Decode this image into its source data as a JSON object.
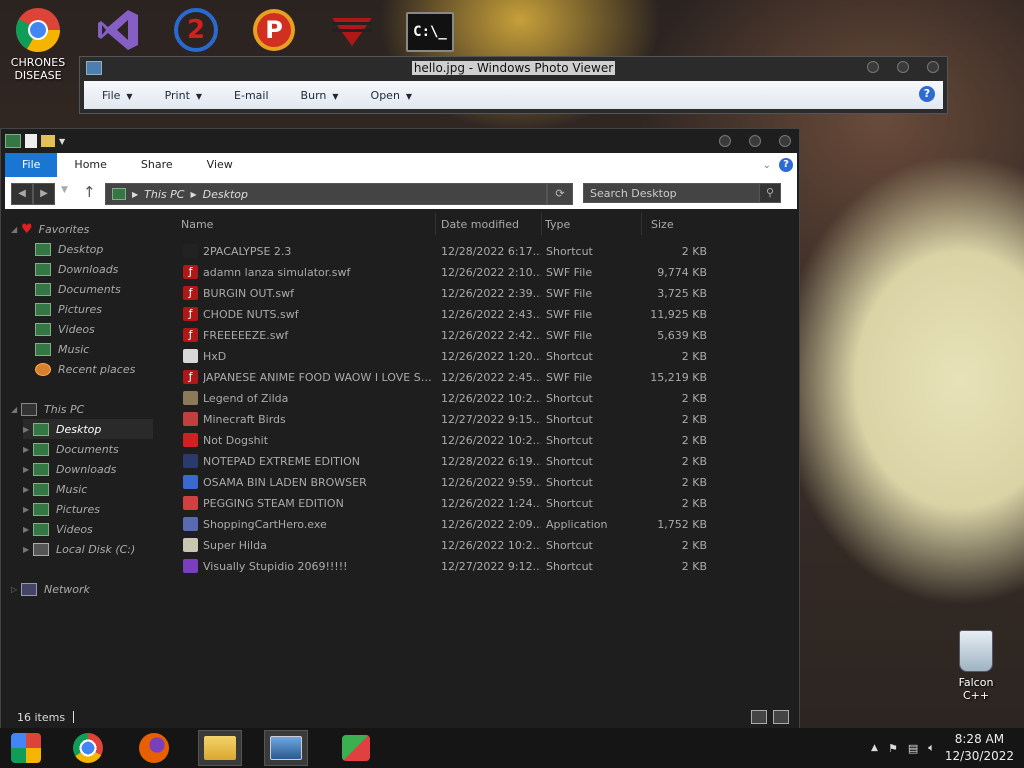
{
  "desktop": {
    "icons": [
      {
        "name": "chrome",
        "label": "CHRONES DISEASE"
      },
      {
        "name": "visual-studio",
        "label": ""
      },
      {
        "name": "game-2",
        "label": ""
      },
      {
        "name": "game-p",
        "label": ""
      },
      {
        "name": "game-z",
        "label": ""
      },
      {
        "name": "cmd",
        "label": ""
      }
    ],
    "recycle_bin_label": "Falcon C++"
  },
  "photo_viewer": {
    "title": "hello.jpg - Windows Photo Viewer",
    "menu": [
      {
        "label": "File",
        "caret": true
      },
      {
        "label": "Print",
        "caret": true
      },
      {
        "label": "E-mail",
        "caret": false
      },
      {
        "label": "Burn",
        "caret": true
      },
      {
        "label": "Open",
        "caret": true
      }
    ],
    "help": "?"
  },
  "explorer": {
    "ribbon_tabs": [
      "File",
      "Home",
      "Share",
      "View"
    ],
    "breadcrumb": {
      "root": "This PC",
      "current": "Desktop"
    },
    "search_placeholder": "Search Desktop",
    "nav": {
      "favorites_label": "Favorites",
      "favorites": [
        "Desktop",
        "Downloads",
        "Documents",
        "Pictures",
        "Videos",
        "Music",
        "Recent places"
      ],
      "this_pc_label": "This PC",
      "this_pc": [
        "Desktop",
        "Documents",
        "Downloads",
        "Music",
        "Pictures",
        "Videos",
        "Local Disk (C:)"
      ],
      "network_label": "Network",
      "selected": "Desktop"
    },
    "columns": [
      "Name",
      "Date modified",
      "Type",
      "Size"
    ],
    "files": [
      {
        "name": "2PACALYPSE 2.3",
        "date": "12/28/2022 6:17...",
        "type": "Shortcut",
        "size": "2 KB",
        "icon": "cmd-icon",
        "color": "#222222"
      },
      {
        "name": "adamn lanza simulator.swf",
        "date": "12/26/2022 2:10...",
        "type": "SWF File",
        "size": "9,774 KB",
        "icon": "flash-icon",
        "color": "#b01818"
      },
      {
        "name": "BURGIN OUT.swf",
        "date": "12/26/2022 2:39...",
        "type": "SWF File",
        "size": "3,725 KB",
        "icon": "flash-icon",
        "color": "#b01818"
      },
      {
        "name": "CHODE NUTS.swf",
        "date": "12/26/2022 2:43...",
        "type": "SWF File",
        "size": "11,925 KB",
        "icon": "flash-icon",
        "color": "#b01818"
      },
      {
        "name": "FREEEEEZE.swf",
        "date": "12/26/2022 2:42...",
        "type": "SWF File",
        "size": "5,639 KB",
        "icon": "flash-icon",
        "color": "#b01818"
      },
      {
        "name": "HxD",
        "date": "12/26/2022 1:20...",
        "type": "Shortcut",
        "size": "2 KB",
        "icon": "hxd-icon",
        "color": "#d8d8d8"
      },
      {
        "name": "JAPANESE ANIME FOOD WAOW I LOVE SU...",
        "date": "12/26/2022 2:45...",
        "type": "SWF File",
        "size": "15,219 KB",
        "icon": "flash-icon",
        "color": "#b01818"
      },
      {
        "name": "Legend of Zilda",
        "date": "12/26/2022 10:2...",
        "type": "Shortcut",
        "size": "2 KB",
        "icon": "zilda-icon",
        "color": "#8a7a5a"
      },
      {
        "name": "Minecraft Birds",
        "date": "12/27/2022 9:15...",
        "type": "Shortcut",
        "size": "2 KB",
        "icon": "bird-icon",
        "color": "#c04040"
      },
      {
        "name": "Not Dogshit",
        "date": "12/26/2022 10:2...",
        "type": "Shortcut",
        "size": "2 KB",
        "icon": "devc-icon",
        "color": "#d02020"
      },
      {
        "name": "NOTEPAD EXTREME EDITION",
        "date": "12/28/2022 6:19...",
        "type": "Shortcut",
        "size": "2 KB",
        "icon": "notepad-icon",
        "color": "#2a3a6a"
      },
      {
        "name": "OSAMA BIN LADEN BROWSER",
        "date": "12/26/2022 9:59...",
        "type": "Shortcut",
        "size": "2 KB",
        "icon": "browser-icon",
        "color": "#3a6ad0"
      },
      {
        "name": "PEGGING STEAM EDITION",
        "date": "12/26/2022 1:24...",
        "type": "Shortcut",
        "size": "2 KB",
        "icon": "peg-icon",
        "color": "#d04040"
      },
      {
        "name": "ShoppingCartHero.exe",
        "date": "12/26/2022 2:09...",
        "type": "Application",
        "size": "1,752 KB",
        "icon": "app-icon",
        "color": "#5a6ab0"
      },
      {
        "name": "Super Hilda",
        "date": "12/26/2022 10:2...",
        "type": "Shortcut",
        "size": "2 KB",
        "icon": "hilda-icon",
        "color": "#c8c8b0"
      },
      {
        "name": "Visually Stupidio 2069!!!!!",
        "date": "12/27/2022 9:12...",
        "type": "Shortcut",
        "size": "2 KB",
        "icon": "vs-icon",
        "color": "#7a3fbf"
      }
    ],
    "status": "16 items"
  },
  "taskbar": {
    "apps": [
      "start-icon",
      "chrome-icon",
      "firefox-icon",
      "explorer-icon",
      "photo-viewer-icon",
      "people-icon"
    ],
    "time": "8:28 AM",
    "date": "12/30/2022"
  }
}
